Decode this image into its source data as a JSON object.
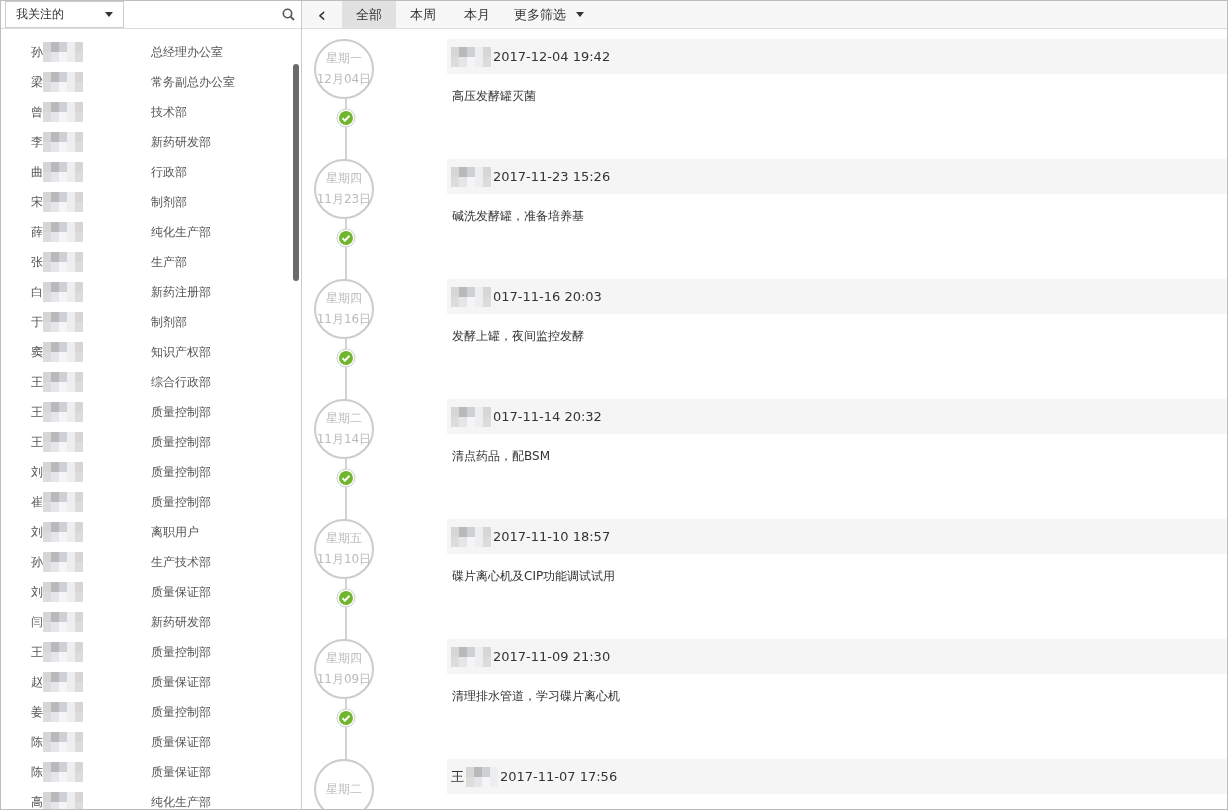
{
  "sidebar": {
    "filter": {
      "label": "我关注的"
    },
    "contacts": [
      {
        "name": "孙",
        "department": "总经理办公室"
      },
      {
        "name": "梁",
        "department": "常务副总办公室"
      },
      {
        "name": "曾",
        "department": "技术部"
      },
      {
        "name": "李",
        "department": "新药研发部"
      },
      {
        "name": "曲",
        "department": "行政部"
      },
      {
        "name": "宋",
        "department": "制剂部"
      },
      {
        "name": "薛",
        "department": "纯化生产部"
      },
      {
        "name": "张",
        "department": "生产部"
      },
      {
        "name": "白",
        "department": "新药注册部"
      },
      {
        "name": "于",
        "department": "制剂部"
      },
      {
        "name": "窦",
        "department": "知识产权部"
      },
      {
        "name": "王",
        "department": "综合行政部"
      },
      {
        "name": "王",
        "department": "质量控制部"
      },
      {
        "name": "王",
        "department": "质量控制部"
      },
      {
        "name": "刘",
        "department": "质量控制部"
      },
      {
        "name": "崔",
        "department": "质量控制部"
      },
      {
        "name": "刘",
        "department": "离职用户"
      },
      {
        "name": "孙",
        "department": "生产技术部"
      },
      {
        "name": "刘",
        "department": "质量保证部"
      },
      {
        "name": "闫",
        "department": "新药研发部"
      },
      {
        "name": "王",
        "department": "质量控制部"
      },
      {
        "name": "赵",
        "department": "质量保证部"
      },
      {
        "name": "姜",
        "department": "质量控制部"
      },
      {
        "name": "陈",
        "department": "质量保证部"
      },
      {
        "name": "陈",
        "department": "质量保证部"
      },
      {
        "name": "高",
        "department": "纯化生产部"
      }
    ]
  },
  "toolbar": {
    "back": "‹",
    "tabs": [
      {
        "label": "全部",
        "selected": true
      },
      {
        "label": "本周",
        "selected": false
      },
      {
        "label": "本月",
        "selected": false
      }
    ],
    "more_filter": {
      "label": "更多筛选"
    }
  },
  "timeline": [
    {
      "weekday": "星期一",
      "date": "12月04日",
      "time": "2017-12-04 19:42",
      "note": "高压发酵罐灭菌",
      "done": true
    },
    {
      "weekday": "星期四",
      "date": "11月23日",
      "time": "2017-11-23 15:26",
      "note": "碱洗发酵罐，准备培养基",
      "done": true
    },
    {
      "weekday": "星期四",
      "date": "11月16日",
      "time": "017-11-16 20:03",
      "note": "发酵上罐，夜间监控发酵",
      "done": true
    },
    {
      "weekday": "星期二",
      "date": "11月14日",
      "time": "017-11-14 20:32",
      "note": "清点药品，配BSM",
      "done": true
    },
    {
      "weekday": "星期五",
      "date": "11月10日",
      "time": "2017-11-10 18:57",
      "note": "碟片离心机及CIP功能调试试用",
      "done": true
    },
    {
      "weekday": "星期四",
      "date": "11月09日",
      "time": "2017-11-09 21:30",
      "note": "清理排水管道，学习碟片离心机",
      "done": true
    },
    {
      "weekday": "星期二",
      "author": "王",
      "time": "2017-11-07 17:56"
    }
  ]
}
